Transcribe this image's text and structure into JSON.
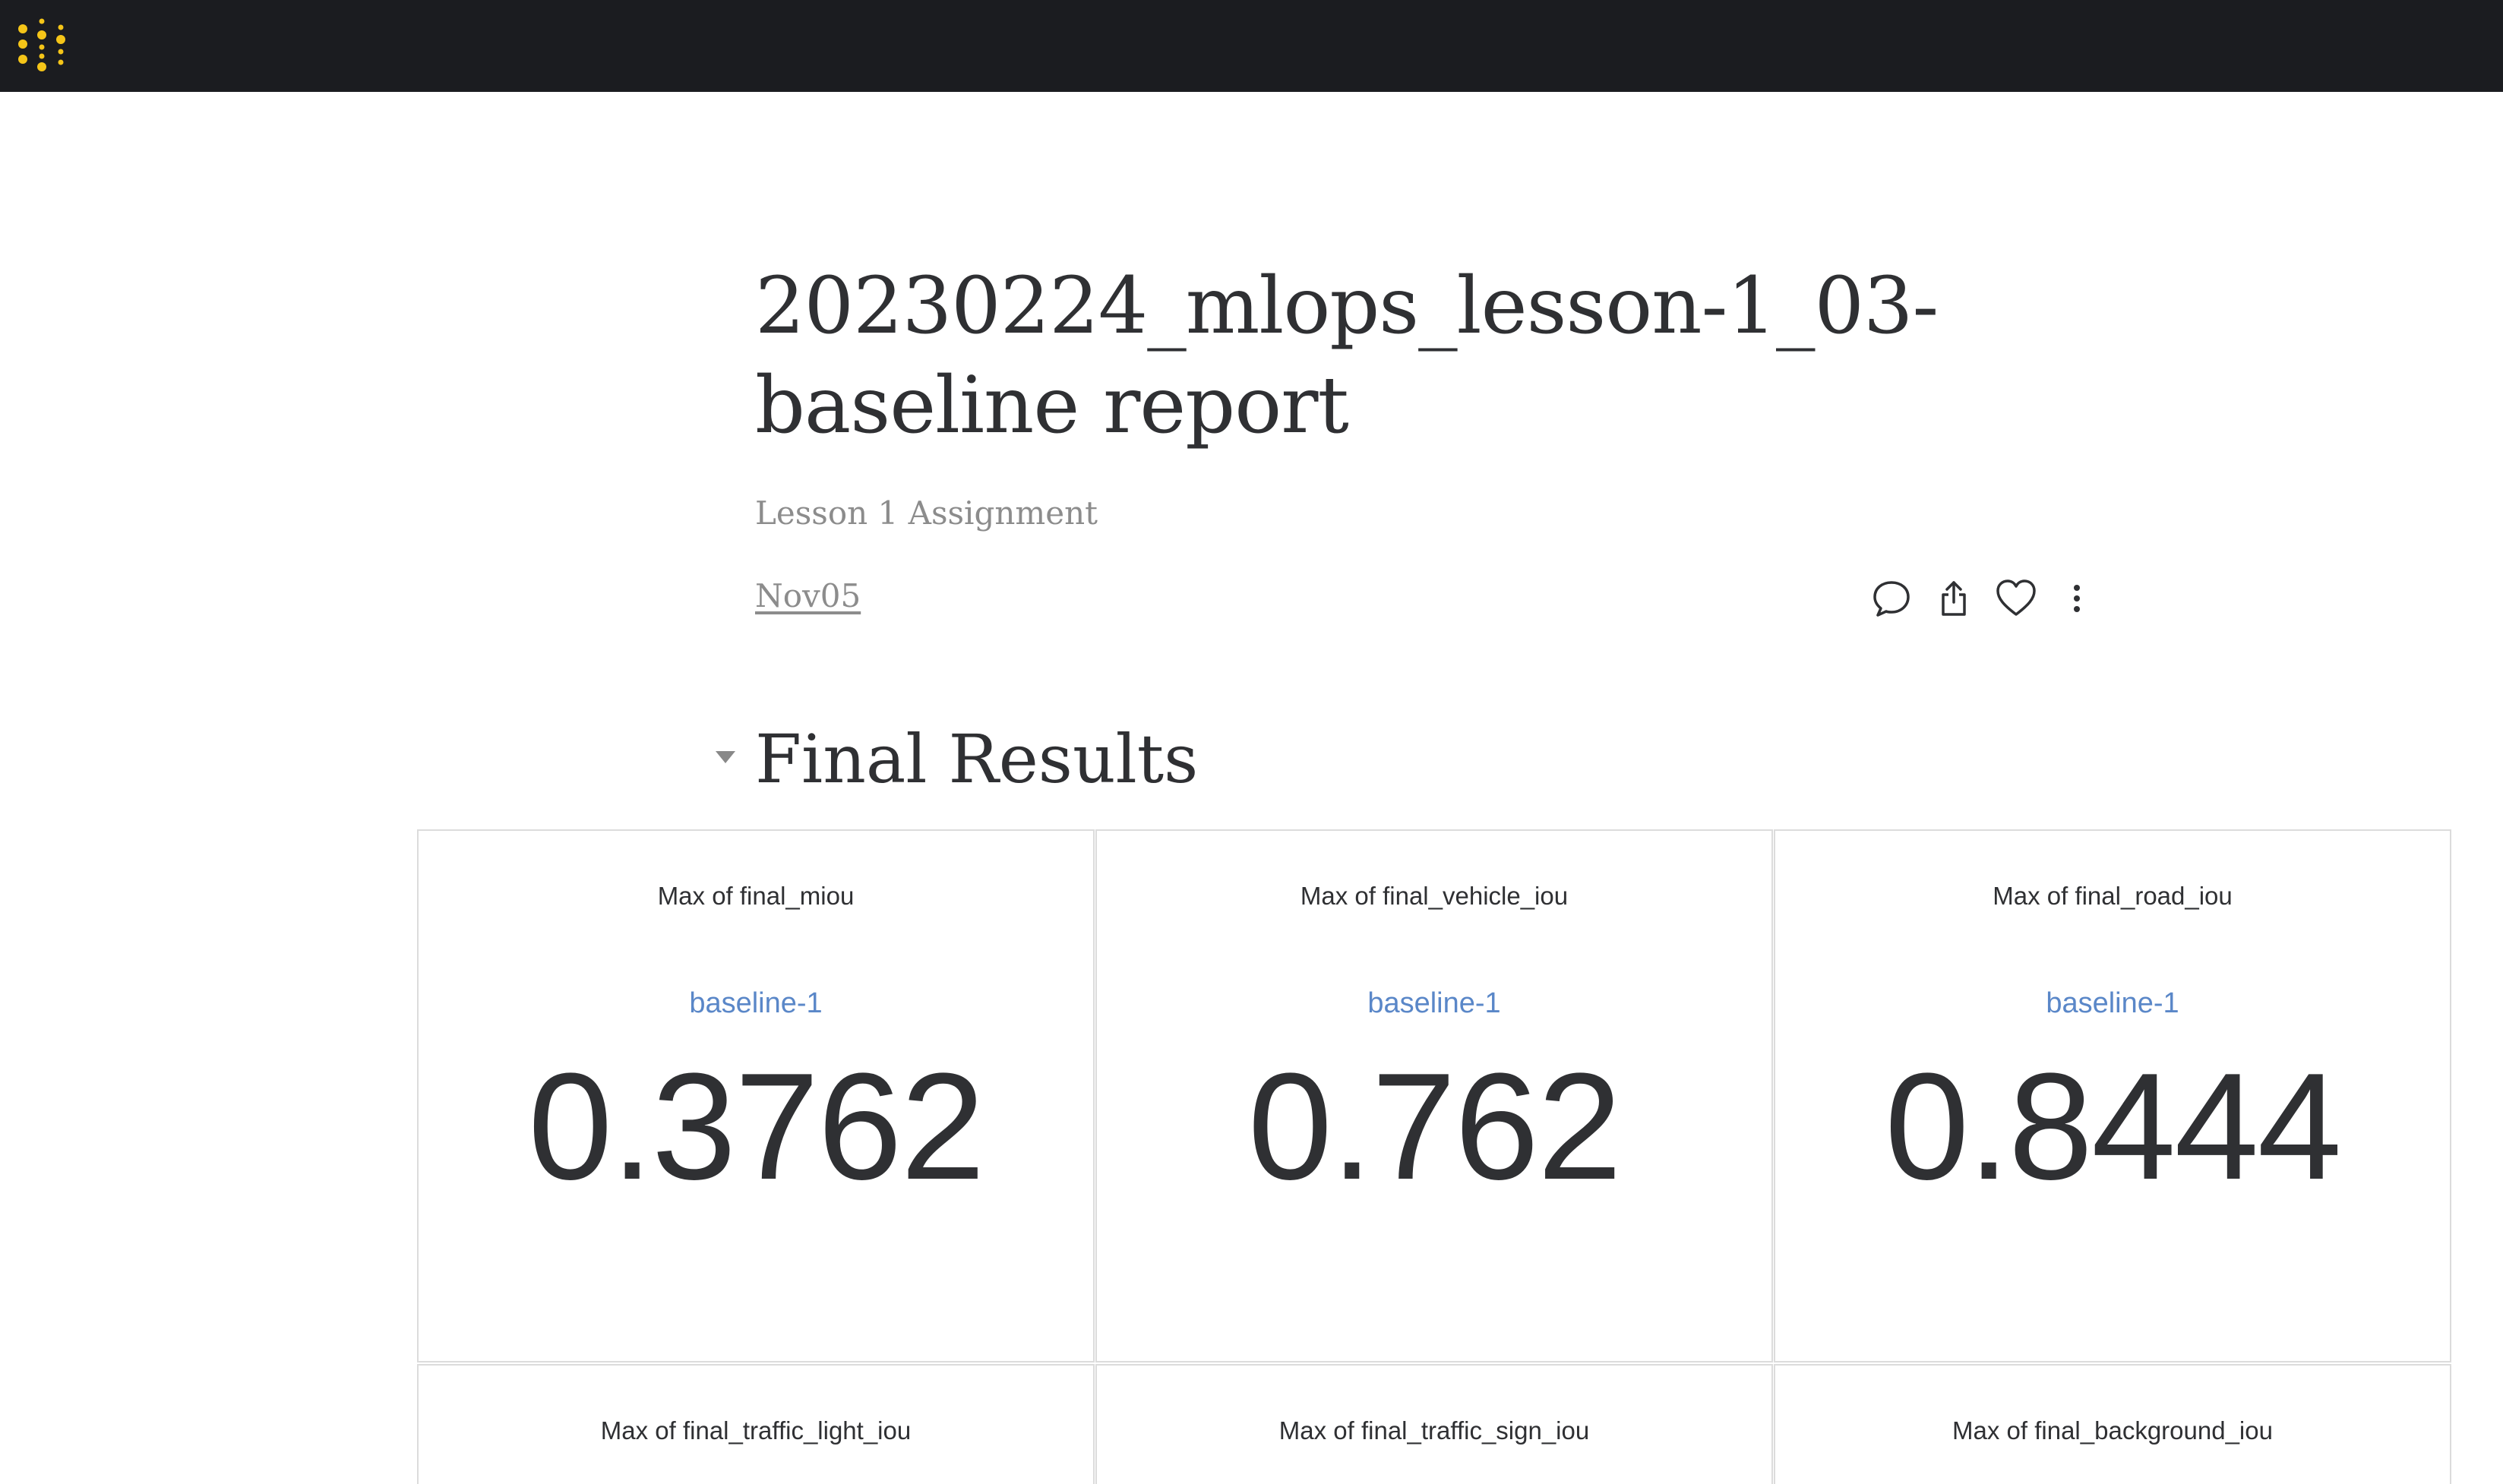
{
  "header": {
    "logo_icon": "weights-and-biases-dots-icon",
    "brand_color": "#f5c518"
  },
  "report": {
    "title": "20230224_mlops_lesson-1_03-baseline report",
    "subtitle": "Lesson 1 Assignment",
    "date": "Nov05",
    "actions": {
      "comment_icon": "comment-icon",
      "share_icon": "share-icon",
      "like_icon": "heart-icon",
      "more_icon": "more-vertical-icon"
    }
  },
  "section": {
    "title": "Final Results",
    "collapse_icon": "caret-down-icon"
  },
  "panels": [
    {
      "title": "Max of final_miou",
      "run": "baseline-1",
      "value": "0.3762"
    },
    {
      "title": "Max of final_vehicle_iou",
      "run": "baseline-1",
      "value": "0.762"
    },
    {
      "title": "Max of final_road_iou",
      "run": "baseline-1",
      "value": "0.8444"
    },
    {
      "title": "Max of final_traffic_light_iou"
    },
    {
      "title": "Max of final_traffic_sign_iou"
    },
    {
      "title": "Max of final_background_iou"
    }
  ],
  "colors": {
    "topbar": "#1b1c20",
    "run_link": "#5a87c8",
    "text": "#2f3033",
    "muted": "#8c8c8c"
  }
}
